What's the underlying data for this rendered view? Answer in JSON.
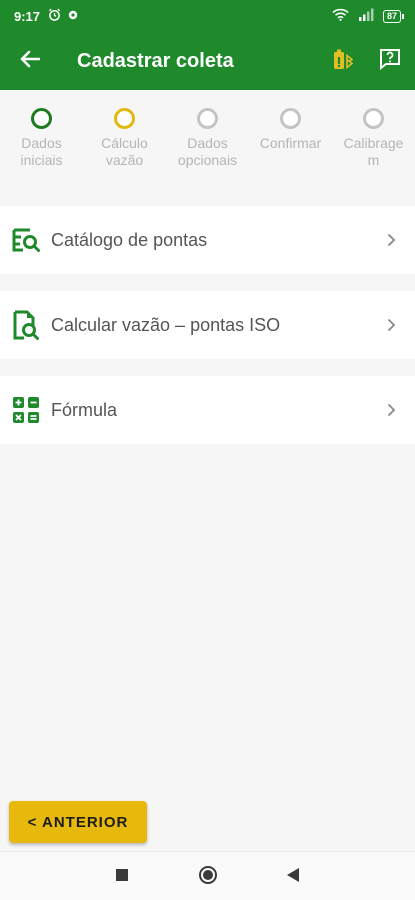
{
  "status_bar": {
    "time": "9:17",
    "battery": "87"
  },
  "app_bar": {
    "title": "Cadastrar coleta",
    "back_icon": "arrow-left-icon",
    "actions": [
      "battery-bluetooth-icon",
      "help-chat-icon"
    ]
  },
  "stepper": {
    "steps": [
      {
        "line1": "Dados",
        "line2": "iniciais",
        "state": "done"
      },
      {
        "line1": "Cálculo",
        "line2": "vazão",
        "state": "current"
      },
      {
        "line1": "Dados",
        "line2": "opcionais",
        "state": "pending"
      },
      {
        "line1": "Confirmar",
        "line2": "",
        "state": "pending"
      },
      {
        "line1": "Calibrage",
        "line2": "m",
        "state": "pending"
      }
    ]
  },
  "menu": {
    "items": [
      {
        "label": "Catálogo de pontas",
        "icon": "catalog-search-icon"
      },
      {
        "label": "Calcular vazão – pontas ISO",
        "icon": "document-search-icon"
      },
      {
        "label": "Fórmula",
        "icon": "calculator-icon"
      }
    ]
  },
  "footer": {
    "previous_label": "< ANTERIOR"
  },
  "colors": {
    "primary": "#1f8a2c",
    "accent": "#e7b90c",
    "step_done": "#1f7a1f",
    "step_pending": "#c4c4c4"
  },
  "nav": [
    "recents-square-icon",
    "home-circle-icon",
    "back-triangle-icon"
  ]
}
